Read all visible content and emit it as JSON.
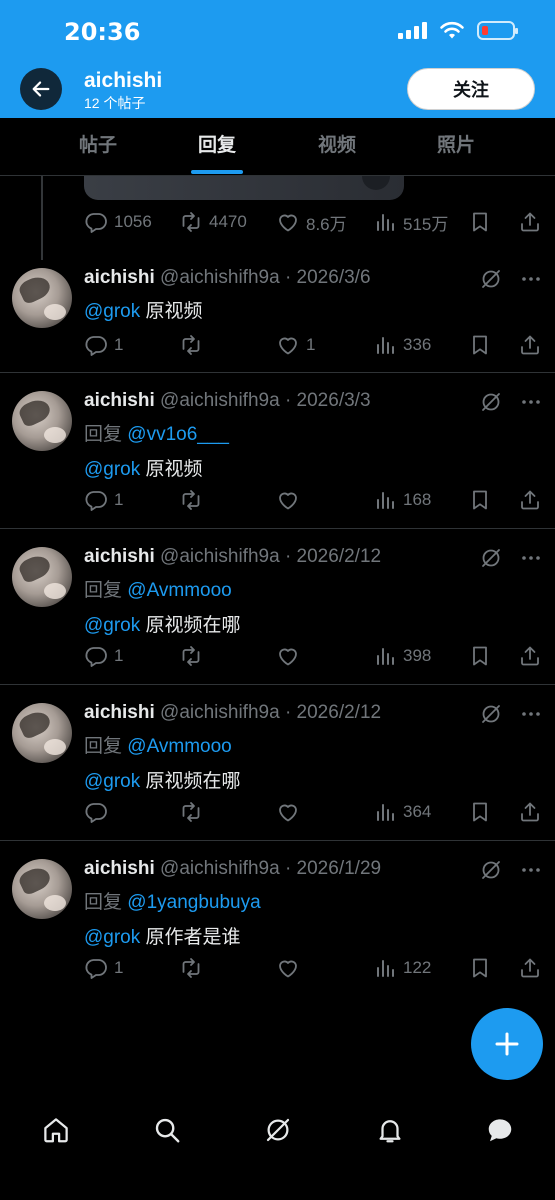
{
  "status_bar": {
    "time": "20:36"
  },
  "header": {
    "title": "aichishi",
    "subtitle": "12 个帖子",
    "follow_label": "关注"
  },
  "tabs": [
    {
      "label": "帖子"
    },
    {
      "label": "回复"
    },
    {
      "label": "视频"
    },
    {
      "label": "照片"
    }
  ],
  "active_tab": "回复",
  "top_post": {
    "replies": "1056",
    "reposts": "4470",
    "likes": "8.6万",
    "views": "515万"
  },
  "posts": [
    {
      "name": "aichishi",
      "meta": "@aichishifh9a · 2026/3/6",
      "reply_prefix": "",
      "reply_to": "",
      "mention": "@grok",
      "text": " 原视频",
      "replies": "1",
      "reposts": "",
      "likes": "1",
      "views": "336"
    },
    {
      "name": "aichishi",
      "meta": "@aichishifh9a · 2026/3/3",
      "reply_prefix": "回复 ",
      "reply_to": "@vv1o6___",
      "mention": "@grok",
      "text": " 原视频",
      "replies": "1",
      "reposts": "",
      "likes": "",
      "views": "168"
    },
    {
      "name": "aichishi",
      "meta": "@aichishifh9a · 2026/2/12",
      "reply_prefix": "回复 ",
      "reply_to": "@Avmmooo",
      "mention": "@grok",
      "text": " 原视频在哪",
      "replies": "1",
      "reposts": "",
      "likes": "",
      "views": "398"
    },
    {
      "name": "aichishi",
      "meta": "@aichishifh9a · 2026/2/12",
      "reply_prefix": "回复 ",
      "reply_to": "@Avmmooo",
      "mention": "@grok",
      "text": " 原视频在哪",
      "replies": "",
      "reposts": "",
      "likes": "",
      "views": "364"
    },
    {
      "name": "aichishi",
      "meta": "@aichishifh9a · 2026/1/29",
      "reply_prefix": "回复 ",
      "reply_to": "@1yangbubuya",
      "mention": "@grok",
      "text": " 原作者是谁",
      "replies": "1",
      "reposts": "",
      "likes": "",
      "views": "122"
    }
  ],
  "icons": {
    "back": "arrow-left-icon",
    "reply": "reply-icon",
    "repost": "repost-icon",
    "like": "heart-icon",
    "views": "views-icon",
    "bookmark": "bookmark-icon",
    "share": "share-icon",
    "grok": "grok-icon",
    "more": "more-icon",
    "compose": "plus-icon",
    "nav": [
      "home-icon",
      "search-icon",
      "grok-icon",
      "notifications-icon",
      "messages-icon"
    ]
  },
  "colors": {
    "accent": "#1d9bf0",
    "background": "#000000",
    "muted": "#71767b",
    "battery_low": "#ff3b30"
  }
}
